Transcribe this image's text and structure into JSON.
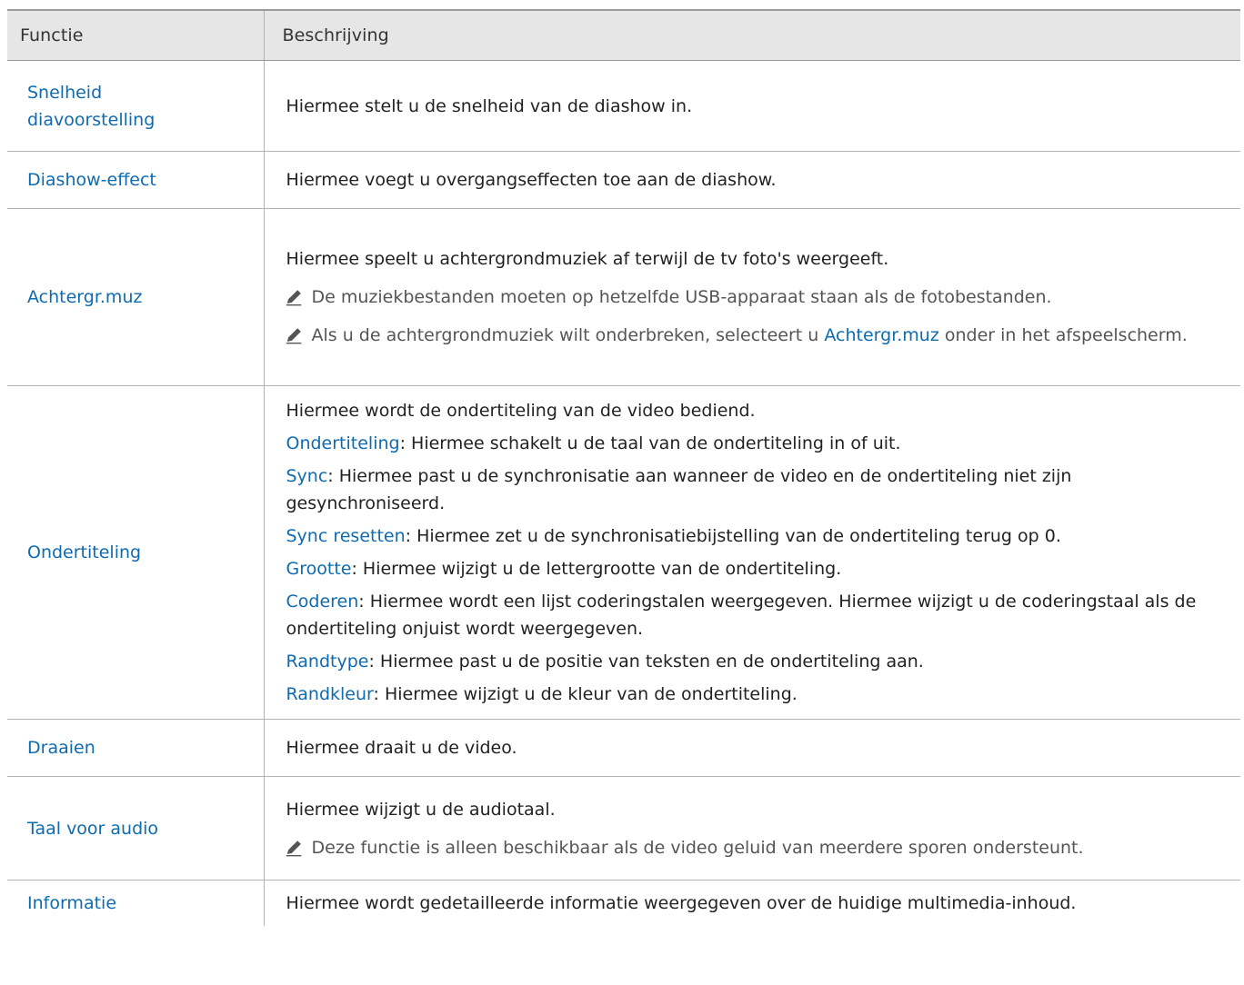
{
  "header": {
    "col1": "Functie",
    "col2": "Beschrijving"
  },
  "rows": [
    {
      "name": "Snelheid diavoorstelling",
      "desc": "Hiermee stelt u de snelheid van de diashow in."
    },
    {
      "name": "Diashow-effect",
      "desc": "Hiermee voegt u overgangseffecten toe aan de diashow."
    },
    {
      "name": "Achtergr.muz",
      "desc": "Hiermee speelt u achtergrondmuziek af terwijl de tv foto's weergeeft.",
      "note1": "De muziekbestanden moeten op hetzelfde USB-apparaat staan als de fotobestanden.",
      "note2_pre": "Als u de achtergrondmuziek wilt onderbreken, selecteert u ",
      "note2_kw": "Achtergr.muz",
      "note2_post": " onder in het afspeelscherm."
    },
    {
      "name": "Ondertiteling",
      "desc": "Hiermee wordt de ondertiteling van de video bediend.",
      "items": [
        {
          "kw": "Ondertiteling",
          "text": ": Hiermee schakelt u de taal van de ondertiteling in of uit."
        },
        {
          "kw": "Sync",
          "text": ": Hiermee past u de synchronisatie aan wanneer de video en de ondertiteling niet zijn gesynchroniseerd."
        },
        {
          "kw": "Sync resetten",
          "text": ": Hiermee zet u de synchronisatiebijstelling van de ondertiteling terug op 0."
        },
        {
          "kw": "Grootte",
          "text": ": Hiermee wijzigt u de lettergrootte van de ondertiteling."
        },
        {
          "kw": "Coderen",
          "text": ": Hiermee wordt een lijst coderingstalen weergegeven. Hiermee wijzigt u de coderingstaal als de ondertiteling onjuist wordt weergegeven."
        },
        {
          "kw": "Randtype",
          "text": ": Hiermee past u de positie van teksten en de ondertiteling aan."
        },
        {
          "kw": "Randkleur",
          "text": ": Hiermee wijzigt u de kleur van de ondertiteling."
        }
      ]
    },
    {
      "name": "Draaien",
      "desc": "Hiermee draait u de video."
    },
    {
      "name": "Taal voor audio",
      "desc": "Hiermee wijzigt u de audiotaal.",
      "note1": "Deze functie is alleen beschikbaar als de video geluid van meerdere sporen ondersteunt."
    },
    {
      "name": "Informatie",
      "desc": "Hiermee wordt gedetailleerde informatie weergegeven over de huidige multimedia-inhoud."
    }
  ],
  "icons": {
    "note": "pencil-icon"
  },
  "colors": {
    "link": "#0f6bb0",
    "header_bg": "#e6e6e6",
    "border": "#b4b4b4",
    "note_text": "#555555"
  }
}
